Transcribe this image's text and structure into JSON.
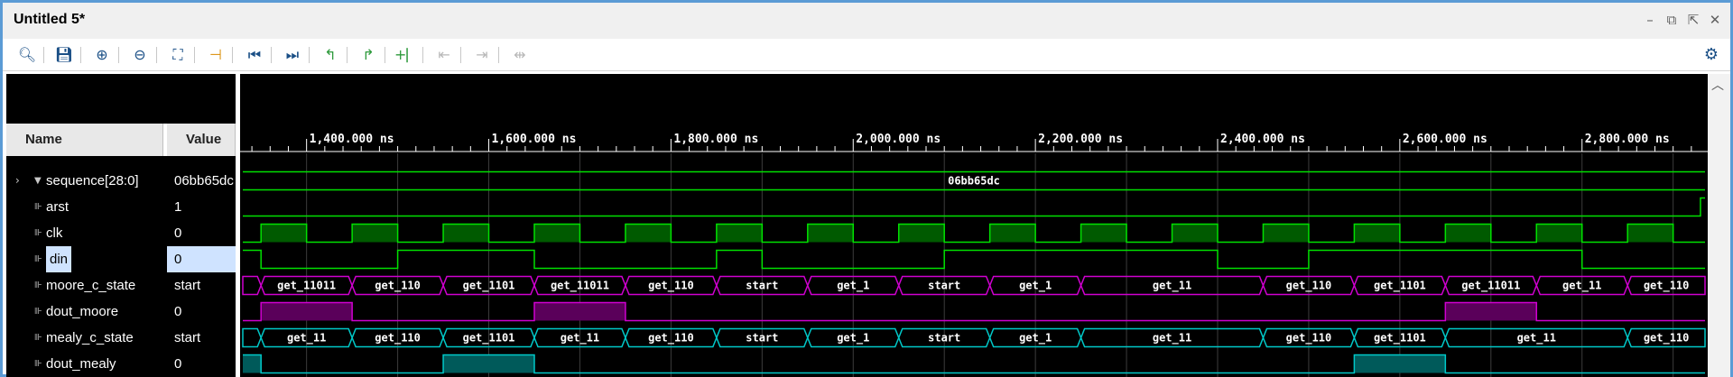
{
  "window": {
    "title": "Untitled 5*"
  },
  "window_controls": [
    {
      "name": "minimize-button",
      "glyph": "–"
    },
    {
      "name": "restore-button",
      "glyph": "⧉"
    },
    {
      "name": "float-button",
      "glyph": "⇱"
    },
    {
      "name": "close-button",
      "glyph": "✕"
    }
  ],
  "toolbar": [
    {
      "name": "search-icon",
      "glyph": "🔍︎",
      "color": "blue"
    },
    {
      "name": "save-icon",
      "glyph": "💾︎",
      "color": "blue"
    },
    {
      "name": "zoom-in-icon",
      "glyph": "⊕",
      "color": "blue"
    },
    {
      "name": "zoom-out-icon",
      "glyph": "⊖",
      "color": "blue"
    },
    {
      "name": "zoom-fit-icon",
      "glyph": "⛶",
      "color": "blue"
    },
    {
      "name": "go-to-cursor-icon",
      "glyph": "⊣",
      "color": "orange"
    },
    {
      "name": "go-to-time-0-icon",
      "glyph": "⏮",
      "color": "blue"
    },
    {
      "name": "go-to-last-time-icon",
      "glyph": "⏭",
      "color": "blue"
    },
    {
      "name": "previous-transition-icon",
      "glyph": "↰",
      "color": "green"
    },
    {
      "name": "next-transition-icon",
      "glyph": "↱",
      "color": "green"
    },
    {
      "name": "add-marker-icon",
      "glyph": "+⎸",
      "color": "green"
    },
    {
      "name": "previous-marker-icon",
      "glyph": "⇤",
      "color": "gray"
    },
    {
      "name": "next-marker-icon",
      "glyph": "⇥",
      "color": "gray"
    },
    {
      "name": "swap-cursors-icon",
      "glyph": "⇹",
      "color": "gray"
    }
  ],
  "settings": {
    "icon": "gear-icon",
    "glyph": "⚙"
  },
  "columns": {
    "name": "Name",
    "value": "Value"
  },
  "signals": [
    {
      "name": "sequence[28:0]",
      "value": "06bb65dc",
      "icon": "bus-icon",
      "expandable": true
    },
    {
      "name": "arst",
      "value": "1",
      "icon": "signal-icon"
    },
    {
      "name": "clk",
      "value": "0",
      "icon": "signal-icon"
    },
    {
      "name": "din",
      "value": "0",
      "icon": "signal-icon",
      "selected": true
    },
    {
      "name": "moore_c_state",
      "value": "start",
      "icon": "signal-icon"
    },
    {
      "name": "dout_moore",
      "value": "0",
      "icon": "signal-icon"
    },
    {
      "name": "mealy_c_state",
      "value": "start",
      "icon": "signal-icon"
    },
    {
      "name": "dout_mealy",
      "value": "0",
      "icon": "signal-icon"
    }
  ],
  "timeline": {
    "unit": "ns",
    "visible_start_ns": 1330,
    "visible_end_ns": 2935,
    "major_labels": [
      "1,400.000 ns",
      "1,600.000 ns",
      "1,800.000 ns",
      "2,000.000 ns",
      "2,200.000 ns",
      "2,400.000 ns",
      "2,600.000 ns",
      "2,800.000 ns"
    ],
    "major_values_ns": [
      1400,
      1600,
      1800,
      2000,
      2200,
      2400,
      2600,
      2800
    ],
    "minor_step_ns": 20
  },
  "colors": {
    "signal_green": "#00e000",
    "clk_fill": "#005a00",
    "moore": "#d000d0",
    "moore_fill": "#5a005a",
    "mealy": "#00c8c8",
    "mealy_fill": "#005a5a",
    "grid": "#3c3c3c"
  },
  "waves": {
    "sequence": {
      "value_label": "06bb65dc"
    },
    "arst": {
      "high_until_ns": null,
      "rise_at_ns": 2930
    },
    "clk": {
      "period_ns": 100,
      "first_rise_ns": 1350,
      "high_ns": 50
    },
    "din": [
      [
        1330,
        1
      ],
      [
        1350,
        0
      ],
      [
        1500,
        1
      ],
      [
        1650,
        0
      ],
      [
        1850,
        1
      ],
      [
        1900,
        0
      ],
      [
        2100,
        1
      ],
      [
        2400,
        0
      ],
      [
        2500,
        1
      ],
      [
        2800,
        0
      ]
    ],
    "moore_c_state": [
      {
        "t": 1330,
        "v": ""
      },
      {
        "t": 1350,
        "v": "get_11011"
      },
      {
        "t": 1450,
        "v": "get_110"
      },
      {
        "t": 1550,
        "v": "get_1101"
      },
      {
        "t": 1650,
        "v": "get_11011"
      },
      {
        "t": 1750,
        "v": "get_110"
      },
      {
        "t": 1850,
        "v": "start"
      },
      {
        "t": 1950,
        "v": "get_1"
      },
      {
        "t": 2050,
        "v": "start"
      },
      {
        "t": 2150,
        "v": "get_1"
      },
      {
        "t": 2250,
        "v": "get_11"
      },
      {
        "t": 2450,
        "v": "get_110"
      },
      {
        "t": 2550,
        "v": "get_1101"
      },
      {
        "t": 2650,
        "v": "get_11011"
      },
      {
        "t": 2750,
        "v": "get_11"
      },
      {
        "t": 2850,
        "v": "get_110"
      }
    ],
    "dout_moore": [
      [
        1330,
        0
      ],
      [
        1350,
        1
      ],
      [
        1450,
        0
      ],
      [
        1650,
        1
      ],
      [
        1750,
        0
      ],
      [
        2650,
        1
      ],
      [
        2750,
        0
      ]
    ],
    "mealy_c_state": [
      {
        "t": 1330,
        "v": ""
      },
      {
        "t": 1350,
        "v": "get_11"
      },
      {
        "t": 1450,
        "v": "get_110"
      },
      {
        "t": 1550,
        "v": "get_1101"
      },
      {
        "t": 1650,
        "v": "get_11"
      },
      {
        "t": 1750,
        "v": "get_110"
      },
      {
        "t": 1850,
        "v": "start"
      },
      {
        "t": 1950,
        "v": "get_1"
      },
      {
        "t": 2050,
        "v": "start"
      },
      {
        "t": 2150,
        "v": "get_1"
      },
      {
        "t": 2250,
        "v": "get_11"
      },
      {
        "t": 2450,
        "v": "get_110"
      },
      {
        "t": 2550,
        "v": "get_1101"
      },
      {
        "t": 2650,
        "v": "get_11"
      },
      {
        "t": 2850,
        "v": "get_110"
      }
    ],
    "dout_mealy": [
      [
        1330,
        1
      ],
      [
        1350,
        0
      ],
      [
        1550,
        1
      ],
      [
        1650,
        0
      ],
      [
        2550,
        1
      ],
      [
        2650,
        0
      ]
    ]
  }
}
